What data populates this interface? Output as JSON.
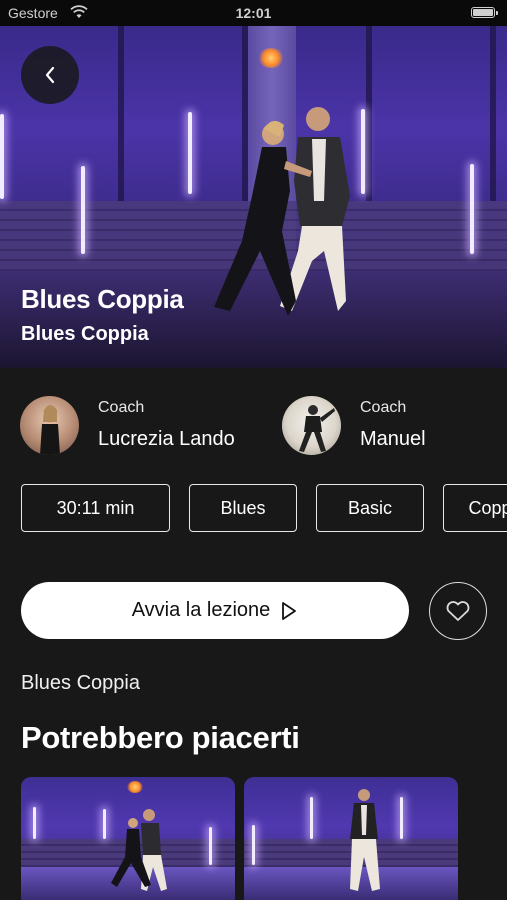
{
  "status_bar": {
    "carrier": "Gestore",
    "time": "12:01"
  },
  "hero": {
    "title": "Blues Coppia",
    "subtitle": "Blues Coppia"
  },
  "coaches": [
    {
      "role": "Coach",
      "name": "Lucrezia Lando"
    },
    {
      "role": "Coach",
      "name": "Manuel"
    }
  ],
  "tags": [
    "30:11 min",
    "Blues",
    "Basic",
    "Coppia"
  ],
  "actions": {
    "start_label": "Avvia la lezione"
  },
  "description": "Blues Coppia",
  "recommendations": {
    "title": "Potrebbero piacerti"
  },
  "colors": {
    "background": "#181818",
    "accent_purple": "#4b34a8",
    "button_bg": "#ffffff"
  }
}
